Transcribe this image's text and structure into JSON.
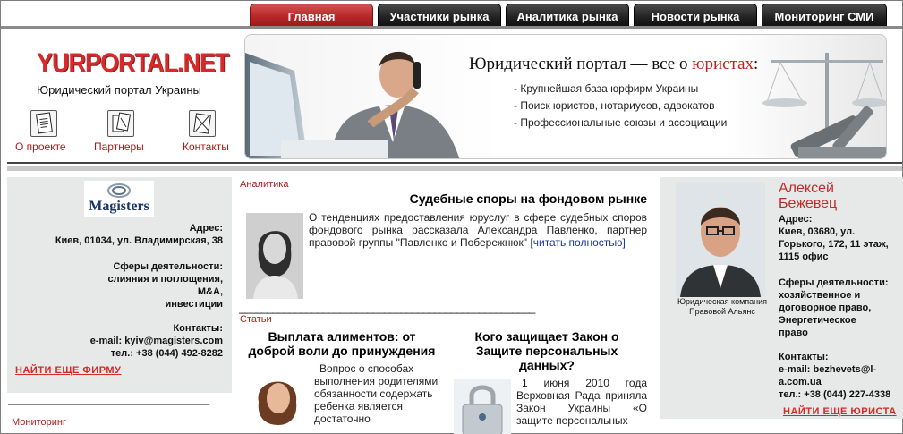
{
  "nav": {
    "tabs": [
      {
        "label": "Главная",
        "active": true
      },
      {
        "label": "Участники рынка",
        "active": false
      },
      {
        "label": "Аналитика рынка",
        "active": false
      },
      {
        "label": "Новости рынка",
        "active": false
      },
      {
        "label": "Мониторинг СМИ",
        "active": false
      }
    ]
  },
  "header": {
    "logo": "YURPORTAL.NET",
    "subtitle": "Юридический портал Украины",
    "links": [
      {
        "label": "О проекте",
        "icon": "document-icon"
      },
      {
        "label": "Партнеры",
        "icon": "documents-icon"
      },
      {
        "label": "Контакты",
        "icon": "envelope-icon"
      }
    ]
  },
  "banner": {
    "title_main": "Юридический портал — все о ",
    "title_accent": "юристах",
    "title_end": ":",
    "items": [
      "- Крупнейшая база юрфирм Украины",
      "- Поиск юристов, нотариусов, адвокатов",
      "- Профессиональные союзы и ассоциации"
    ]
  },
  "left": {
    "company_logo": "Magisters",
    "address_label": "Адрес:",
    "address": "Киев, 01034, ул. Владимирская, 38",
    "spheres_label": "Сферы деятельности:",
    "spheres_1": "слияния и поглощения,",
    "spheres_2": "M&A,",
    "spheres_3": "инвестиции",
    "contacts_label": "Контакты:",
    "email": "e-mail: kyiv@magisters.com",
    "phone": "тел.: +38 (044) 492-8282",
    "find_link": "НАЙТИ ЕЩЕ ФИРМУ",
    "dashes": "____________________________________",
    "monitoring_label": "Мониторинг"
  },
  "analytics": {
    "section": "Аналитика",
    "title": "Судебные споры на фондовом рынке",
    "text": "О тенденциях предоставления юруслуг в сфере судебных споров фондового рынка рассказала Александра Павленко, партнер правовой группы \"Павленко и Побережнюк\"",
    "more": "[читать полностью]",
    "dashes": "_____________________________________________________"
  },
  "articles": {
    "section": "Статьи",
    "a1_title": "Выплата алиментов: от доброй воли до принуждения",
    "a1_text": "Вопрос о способах выполнения родителями обязанности содержать ребенка является достаточно",
    "a2_title": "Кого защищает Закон о Защите персональных данных?",
    "a2_text": "1 июня 2010 года Верховная Рада приняла Закон Украины «О защите персональных"
  },
  "right": {
    "name_line1": "Алексей",
    "name_line2": "Бежевец",
    "address_label": "Адрес:",
    "address_1": "Киев, 03680, ул.",
    "address_2": "Горького, 172, 11 этаж,",
    "address_3": "1115 офис",
    "photo_caption_1": "Юридическая компания",
    "photo_caption_2": "Правовой Альянс",
    "spheres_label": "Сферы деятельности:",
    "spheres_1": "хозяйственное и",
    "spheres_2": "договорное право,",
    "spheres_3": "Энергетическое",
    "spheres_4": "право",
    "contacts_label": "Контакты:",
    "email_1": "e-mail: bezhevets@l-",
    "email_2": "a.com.ua",
    "phone": "тел.: +38 (044) 227-4338",
    "find_link": "НАЙТИ ЕЩЕ ЮРИСТА"
  },
  "colors": {
    "accent_red": "#d32a2a",
    "tab_dark": "#222222",
    "panel_gray": "#e7e8e8"
  }
}
